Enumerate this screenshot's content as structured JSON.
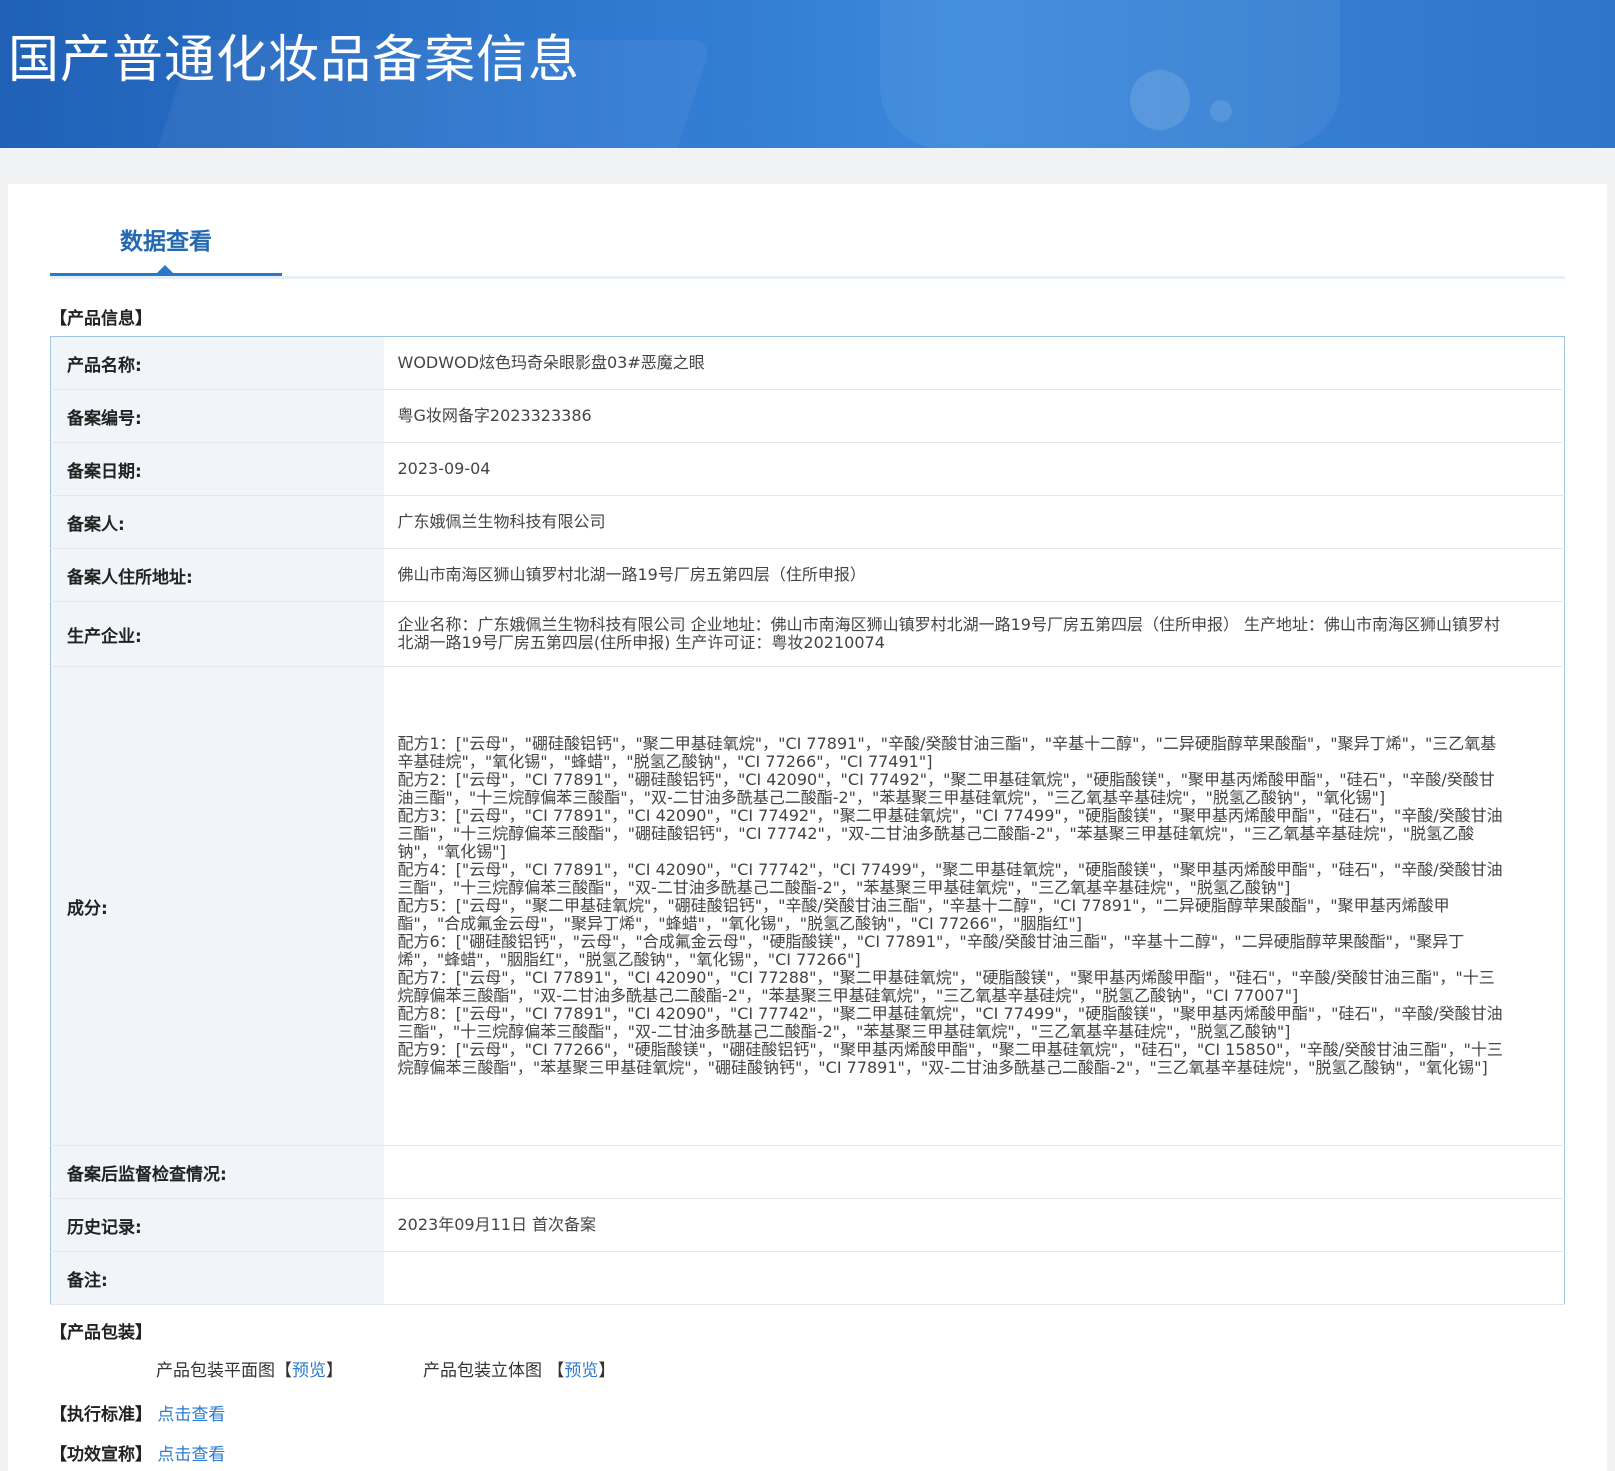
{
  "header": {
    "title": "国产普通化妆品备案信息"
  },
  "tabs": [
    {
      "label": "数据查看",
      "active": true
    }
  ],
  "product_info": {
    "section_title": "【产品信息】",
    "rows": {
      "name": {
        "label": "产品名称:",
        "value": "WODWOD炫色玛奇朵眼影盘03#恶魔之眼"
      },
      "reg_no": {
        "label": "备案编号:",
        "value": "粤G妆网备字2023323386"
      },
      "reg_date": {
        "label": "备案日期:",
        "value": "2023-09-04"
      },
      "registrant": {
        "label": "备案人:",
        "value": "广东娥佩兰生物科技有限公司"
      },
      "address": {
        "label": "备案人住所地址:",
        "value": "佛山市南海区狮山镇罗村北湖一路19号厂房五第四层（住所申报）"
      },
      "manufacturer": {
        "label": "生产企业:",
        "value": "企业名称：广东娥佩兰生物科技有限公司 企业地址：佛山市南海区狮山镇罗村北湖一路19号厂房五第四层（住所申报） 生产地址：佛山市南海区狮山镇罗村北湖一路19号厂房五第四层(住所申报) 生产许可证：粤妆20210074"
      },
      "ingredients": {
        "label": "成分:",
        "formulas": [
          "配方1：[\"云母\"，\"硼硅酸铝钙\"，\"聚二甲基硅氧烷\"，\"CI 77891\"，\"辛酸/癸酸甘油三酯\"，\"辛基十二醇\"，\"二异硬脂醇苹果酸酯\"，\"聚异丁烯\"，\"三乙氧基辛基硅烷\"，\"氧化锡\"，\"蜂蜡\"，\"脱氢乙酸钠\"，\"CI 77266\"，\"CI 77491\"]",
          "配方2：[\"云母\"，\"CI 77891\"，\"硼硅酸铝钙\"，\"CI 42090\"，\"CI 77492\"，\"聚二甲基硅氧烷\"，\"硬脂酸镁\"，\"聚甲基丙烯酸甲酯\"，\"硅石\"，\"辛酸/癸酸甘油三酯\"，\"十三烷醇偏苯三酸酯\"，\"双-二甘油多酰基己二酸酯-2\"，\"苯基聚三甲基硅氧烷\"，\"三乙氧基辛基硅烷\"，\"脱氢乙酸钠\"，\"氧化锡\"]",
          "配方3：[\"云母\"，\"CI 77891\"，\"CI 42090\"，\"CI 77492\"，\"聚二甲基硅氧烷\"，\"CI 77499\"，\"硬脂酸镁\"，\"聚甲基丙烯酸甲酯\"，\"硅石\"，\"辛酸/癸酸甘油三酯\"，\"十三烷醇偏苯三酸酯\"，\"硼硅酸铝钙\"，\"CI 77742\"，\"双-二甘油多酰基己二酸酯-2\"，\"苯基聚三甲基硅氧烷\"，\"三乙氧基辛基硅烷\"，\"脱氢乙酸钠\"，\"氧化锡\"]",
          "配方4：[\"云母\"，\"CI 77891\"，\"CI 42090\"，\"CI 77742\"，\"CI 77499\"，\"聚二甲基硅氧烷\"，\"硬脂酸镁\"，\"聚甲基丙烯酸甲酯\"，\"硅石\"，\"辛酸/癸酸甘油三酯\"，\"十三烷醇偏苯三酸酯\"，\"双-二甘油多酰基己二酸酯-2\"，\"苯基聚三甲基硅氧烷\"，\"三乙氧基辛基硅烷\"，\"脱氢乙酸钠\"]",
          "配方5：[\"云母\"，\"聚二甲基硅氧烷\"，\"硼硅酸铝钙\"，\"辛酸/癸酸甘油三酯\"，\"辛基十二醇\"，\"CI 77891\"，\"二异硬脂醇苹果酸酯\"，\"聚甲基丙烯酸甲酯\"，\"合成氟金云母\"，\"聚异丁烯\"，\"蜂蜡\"，\"氧化锡\"，\"脱氢乙酸钠\"，\"CI 77266\"，\"胭脂红\"]",
          "配方6：[\"硼硅酸铝钙\"，\"云母\"，\"合成氟金云母\"，\"硬脂酸镁\"，\"CI 77891\"，\"辛酸/癸酸甘油三酯\"，\"辛基十二醇\"，\"二异硬脂醇苹果酸酯\"，\"聚异丁烯\"，\"蜂蜡\"，\"胭脂红\"，\"脱氢乙酸钠\"，\"氧化锡\"，\"CI 77266\"]",
          "配方7：[\"云母\"，\"CI 77891\"，\"CI 42090\"，\"CI 77288\"，\"聚二甲基硅氧烷\"，\"硬脂酸镁\"，\"聚甲基丙烯酸甲酯\"，\"硅石\"，\"辛酸/癸酸甘油三酯\"，\"十三烷醇偏苯三酸酯\"，\"双-二甘油多酰基己二酸酯-2\"，\"苯基聚三甲基硅氧烷\"，\"三乙氧基辛基硅烷\"，\"脱氢乙酸钠\"，\"CI 77007\"]",
          "配方8：[\"云母\"，\"CI 77891\"，\"CI 42090\"，\"CI 77742\"，\"聚二甲基硅氧烷\"，\"CI 77499\"，\"硬脂酸镁\"，\"聚甲基丙烯酸甲酯\"，\"硅石\"，\"辛酸/癸酸甘油三酯\"，\"十三烷醇偏苯三酸酯\"，\"双-二甘油多酰基己二酸酯-2\"，\"苯基聚三甲基硅氧烷\"，\"三乙氧基辛基硅烷\"，\"脱氢乙酸钠\"]",
          "配方9：[\"云母\"，\"CI 77266\"，\"硬脂酸镁\"，\"硼硅酸铝钙\"，\"聚甲基丙烯酸甲酯\"，\"聚二甲基硅氧烷\"，\"硅石\"，\"CI 15850\"，\"辛酸/癸酸甘油三酯\"，\"十三烷醇偏苯三酸酯\"，\"苯基聚三甲基硅氧烷\"，\"硼硅酸钠钙\"，\"CI 77891\"，\"双-二甘油多酰基己二酸酯-2\"，\"三乙氧基辛基硅烷\"，\"脱氢乙酸钠\"，\"氧化锡\"]"
        ]
      },
      "inspection": {
        "label": "备案后监督检查情况:",
        "value": ""
      },
      "history": {
        "label": "历史记录:",
        "value": "2023年09月11日 首次备案"
      },
      "remarks": {
        "label": "备注:",
        "value": ""
      }
    }
  },
  "packaging": {
    "section_title": "【产品包装】",
    "flat_label": "产品包装平面图",
    "solid_label": "产品包装立体图",
    "bracket_open": "【",
    "bracket_close": "】",
    "preview_link": "预览"
  },
  "standard": {
    "label": "【执行标准】",
    "link": "点击查看"
  },
  "efficacy": {
    "label": "【功效宣称】",
    "link": "点击查看"
  },
  "colors": {
    "header_bg": "#2e77cf",
    "accent": "#2468b0",
    "link": "#2b7bd0",
    "table_border": "#9ec4e8"
  }
}
